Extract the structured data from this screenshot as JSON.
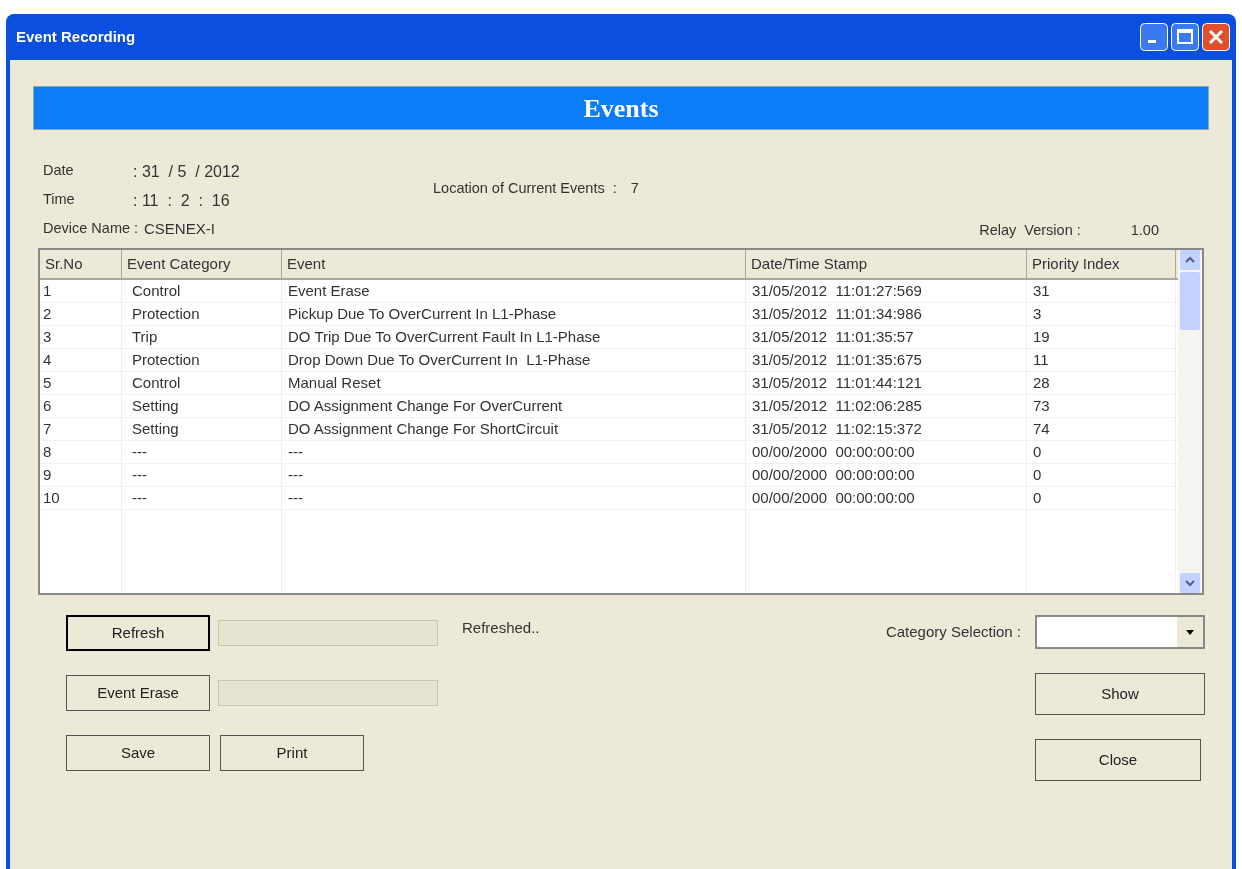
{
  "window": {
    "title": "Event Recording"
  },
  "banner": "Events",
  "info": {
    "date_label": "Date",
    "date_value": ": 31  / 5  / 2012",
    "time_label": "Time",
    "time_value": ": 11  :  2  :  16",
    "device_label": "Device Name :",
    "device_value": "CSENEX-I",
    "location_label": "Location of Current Events  :",
    "location_value": "7",
    "relay_label": "Relay  Version :",
    "relay_value": "1.00"
  },
  "table": {
    "columns": [
      "Sr.No",
      "Event Category",
      "Event",
      "Date/Time Stamp",
      "Priority Index"
    ],
    "rows": [
      [
        "1",
        "Control",
        "Event Erase",
        "31/05/2012  11:01:27:569",
        "31"
      ],
      [
        "2",
        "Protection",
        "Pickup Due To OverCurrent In L1-Phase",
        "31/05/2012  11:01:34:986",
        "3"
      ],
      [
        "3",
        "Trip",
        "DO Trip Due To OverCurrent Fault In L1-Phase",
        "31/05/2012  11:01:35:57",
        "19"
      ],
      [
        "4",
        "Protection",
        "Drop Down Due To OverCurrent In  L1-Phase",
        "31/05/2012  11:01:35:675",
        "11"
      ],
      [
        "5",
        "Control",
        "Manual Reset",
        "31/05/2012  11:01:44:121",
        "28"
      ],
      [
        "6",
        "Setting",
        "DO Assignment Change For OverCurrent",
        "31/05/2012  11:02:06:285",
        "73"
      ],
      [
        "7",
        "Setting",
        "DO Assignment Change For ShortCircuit",
        "31/05/2012  11:02:15:372",
        "74"
      ],
      [
        "8",
        "---",
        "---",
        "00/00/2000  00:00:00:00",
        "0"
      ],
      [
        "9",
        "---",
        "---",
        "00/00/2000  00:00:00:00",
        "0"
      ],
      [
        "10",
        "---",
        "---",
        "00/00/2000  00:00:00:00",
        "0"
      ]
    ]
  },
  "refresh": {
    "label": "Refresh",
    "focused": true,
    "progress": {
      "level": 0
    },
    "status": "Refreshed.."
  },
  "erase": {
    "label": "Event Erase",
    "focused": false,
    "progress": {
      "level": 0
    }
  },
  "save": {
    "label": "Save",
    "focused": false
  },
  "print": {
    "label": "Print",
    "focused": false
  },
  "category": {
    "label": "Category Selection :"
  },
  "show": {
    "label": "Show",
    "focused": false
  },
  "close": {
    "label": "Close",
    "focused": false
  }
}
